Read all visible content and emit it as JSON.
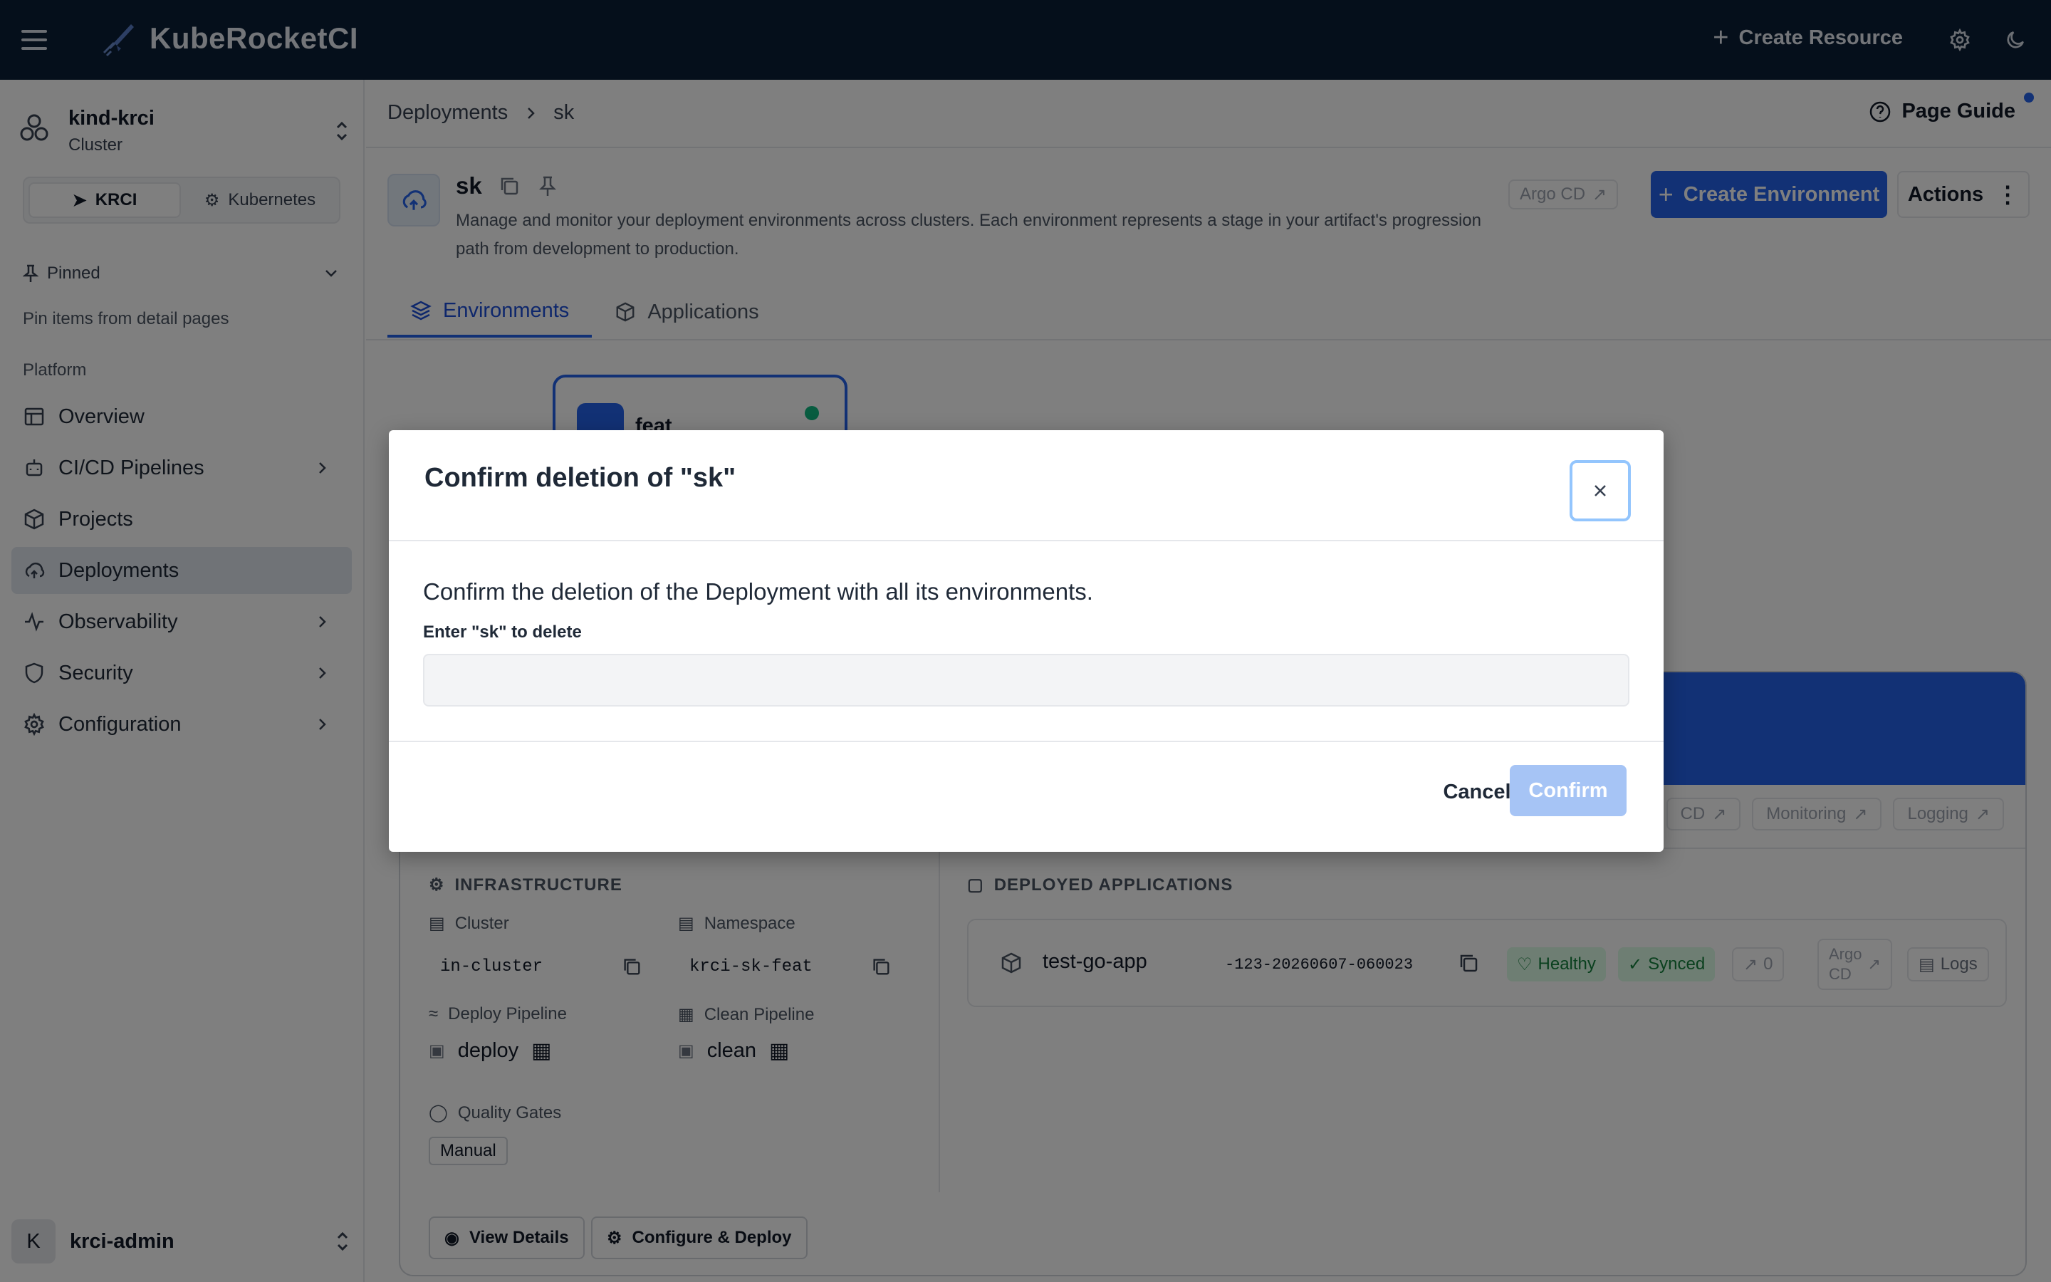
{
  "app": {
    "brand": "KubeRocketCI",
    "create_resource": "Create Resource",
    "icons": {
      "menu": "hamburger-icon",
      "settings": "gear-icon",
      "theme": "moon-icon"
    }
  },
  "sidebar": {
    "cluster_name": "kind-krci",
    "cluster_type": "Cluster",
    "modes": [
      "KRCI",
      "Kubernetes"
    ],
    "pinned_label": "Pinned",
    "pinned_hint": "Pin items from detail pages",
    "platform_label": "Platform",
    "items": [
      {
        "label": "Overview",
        "icon": "overview-icon",
        "has_children": false
      },
      {
        "label": "CI/CD Pipelines",
        "icon": "pipelines-icon",
        "has_children": true
      },
      {
        "label": "Projects",
        "icon": "box-icon",
        "has_children": false
      },
      {
        "label": "Deployments",
        "icon": "cloud-upload-icon",
        "has_children": false,
        "active": true
      },
      {
        "label": "Observability",
        "icon": "activity-icon",
        "has_children": true
      },
      {
        "label": "Security",
        "icon": "shield-icon",
        "has_children": true
      },
      {
        "label": "Configuration",
        "icon": "gear-icon",
        "has_children": true
      }
    ],
    "user_initial": "K",
    "user_name": "krci-admin"
  },
  "breadcrumb": {
    "parent": "Deployments",
    "current": "sk"
  },
  "page_guide": "Page Guide",
  "deployment": {
    "name": "sk",
    "description": "Manage and monitor your deployment environments across clusters. Each environment represents a stage in your artifact's progression path from development to production.",
    "argo_label": "Argo CD",
    "create_env": "Create Environment",
    "actions": "Actions"
  },
  "tabs": [
    "Environments",
    "Applications"
  ],
  "env_card": {
    "name": "feat"
  },
  "env_panel": {
    "links": [
      "CD",
      "Monitoring",
      "Logging"
    ],
    "infrastructure_title": "INFRASTRUCTURE",
    "cluster_label": "Cluster",
    "cluster_value": "in-cluster",
    "namespace_label": "Namespace",
    "namespace_value": "krci-sk-feat",
    "deploy_pipeline_label": "Deploy Pipeline",
    "deploy_pipeline_value": "deploy",
    "clean_pipeline_label": "Clean Pipeline",
    "clean_pipeline_value": "clean",
    "quality_gates_label": "Quality Gates",
    "quality_gate": "Manual",
    "deployed_title": "DEPLOYED APPLICATIONS",
    "app_name": "test-go-app",
    "app_tag": "-123-20260607-060023",
    "health": "Healthy",
    "sync": "Synced",
    "count": "0",
    "argo_line1": "Argo",
    "argo_line2": "CD",
    "logs": "Logs",
    "view_details": "View Details",
    "configure_deploy": "Configure & Deploy"
  },
  "dialog": {
    "title": "Confirm deletion of \"sk\"",
    "message": "Confirm the deletion of the Deployment with all its environments.",
    "input_label": "Enter \"sk\" to delete",
    "input_value": "",
    "cancel": "Cancel",
    "confirm": "Confirm"
  }
}
